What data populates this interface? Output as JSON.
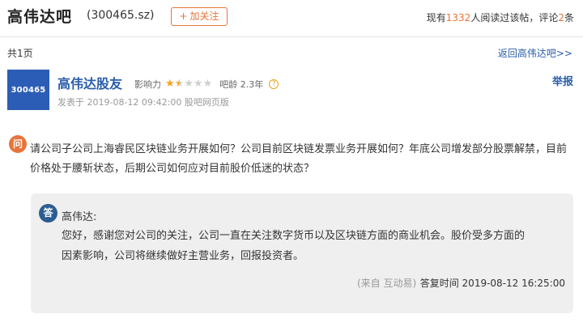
{
  "header": {
    "bar_name": "高伟达吧",
    "stock_code": "(300465.sz)",
    "follow_label": "加关注",
    "follow_plus": "+",
    "read_prefix": "现有",
    "read_count": "1332",
    "read_suffix": "人阅读过该帖，评论",
    "comment_count": "2",
    "comment_suffix": "条"
  },
  "nav": {
    "page_count": "共1页",
    "return_link": "返回高伟达吧>>"
  },
  "post": {
    "avatar_text": "300465",
    "user_name": "高伟达股友",
    "influence_label": "影响力",
    "stars": 1.5,
    "stars_max": 5,
    "age_label": "吧龄 2.3年",
    "help_icon": "?",
    "report_label": "举报",
    "meta": "发表于 2019-08-12 09:42:00 股吧网页版",
    "question_icon": "问",
    "question": "请公司子公司上海睿民区块链业务开展如何？公司目前区块链发票业务开展如何？年底公司增发部分股票解禁，目前价格处于腰斩状态，后期公司如何应对目前股价低迷的状态？"
  },
  "answer": {
    "icon": "答",
    "name": "高伟达:",
    "text": "您好，感谢您对公司的关注，公司一直在关注数字货币以及区块链方面的商业机会。股价受多方面的因素影响，公司将继续做好主营业务，回报投资者。",
    "source": "(来自 互动易)",
    "time": "答复时间 2019-08-12 16:25:00"
  },
  "colors": {
    "accent_orange": "#e8743b",
    "link_blue": "#2a5caa",
    "avatar_blue": "#2c5db6",
    "answer_icon_blue": "#2c5d92",
    "star_gold": "#f7a31a"
  }
}
